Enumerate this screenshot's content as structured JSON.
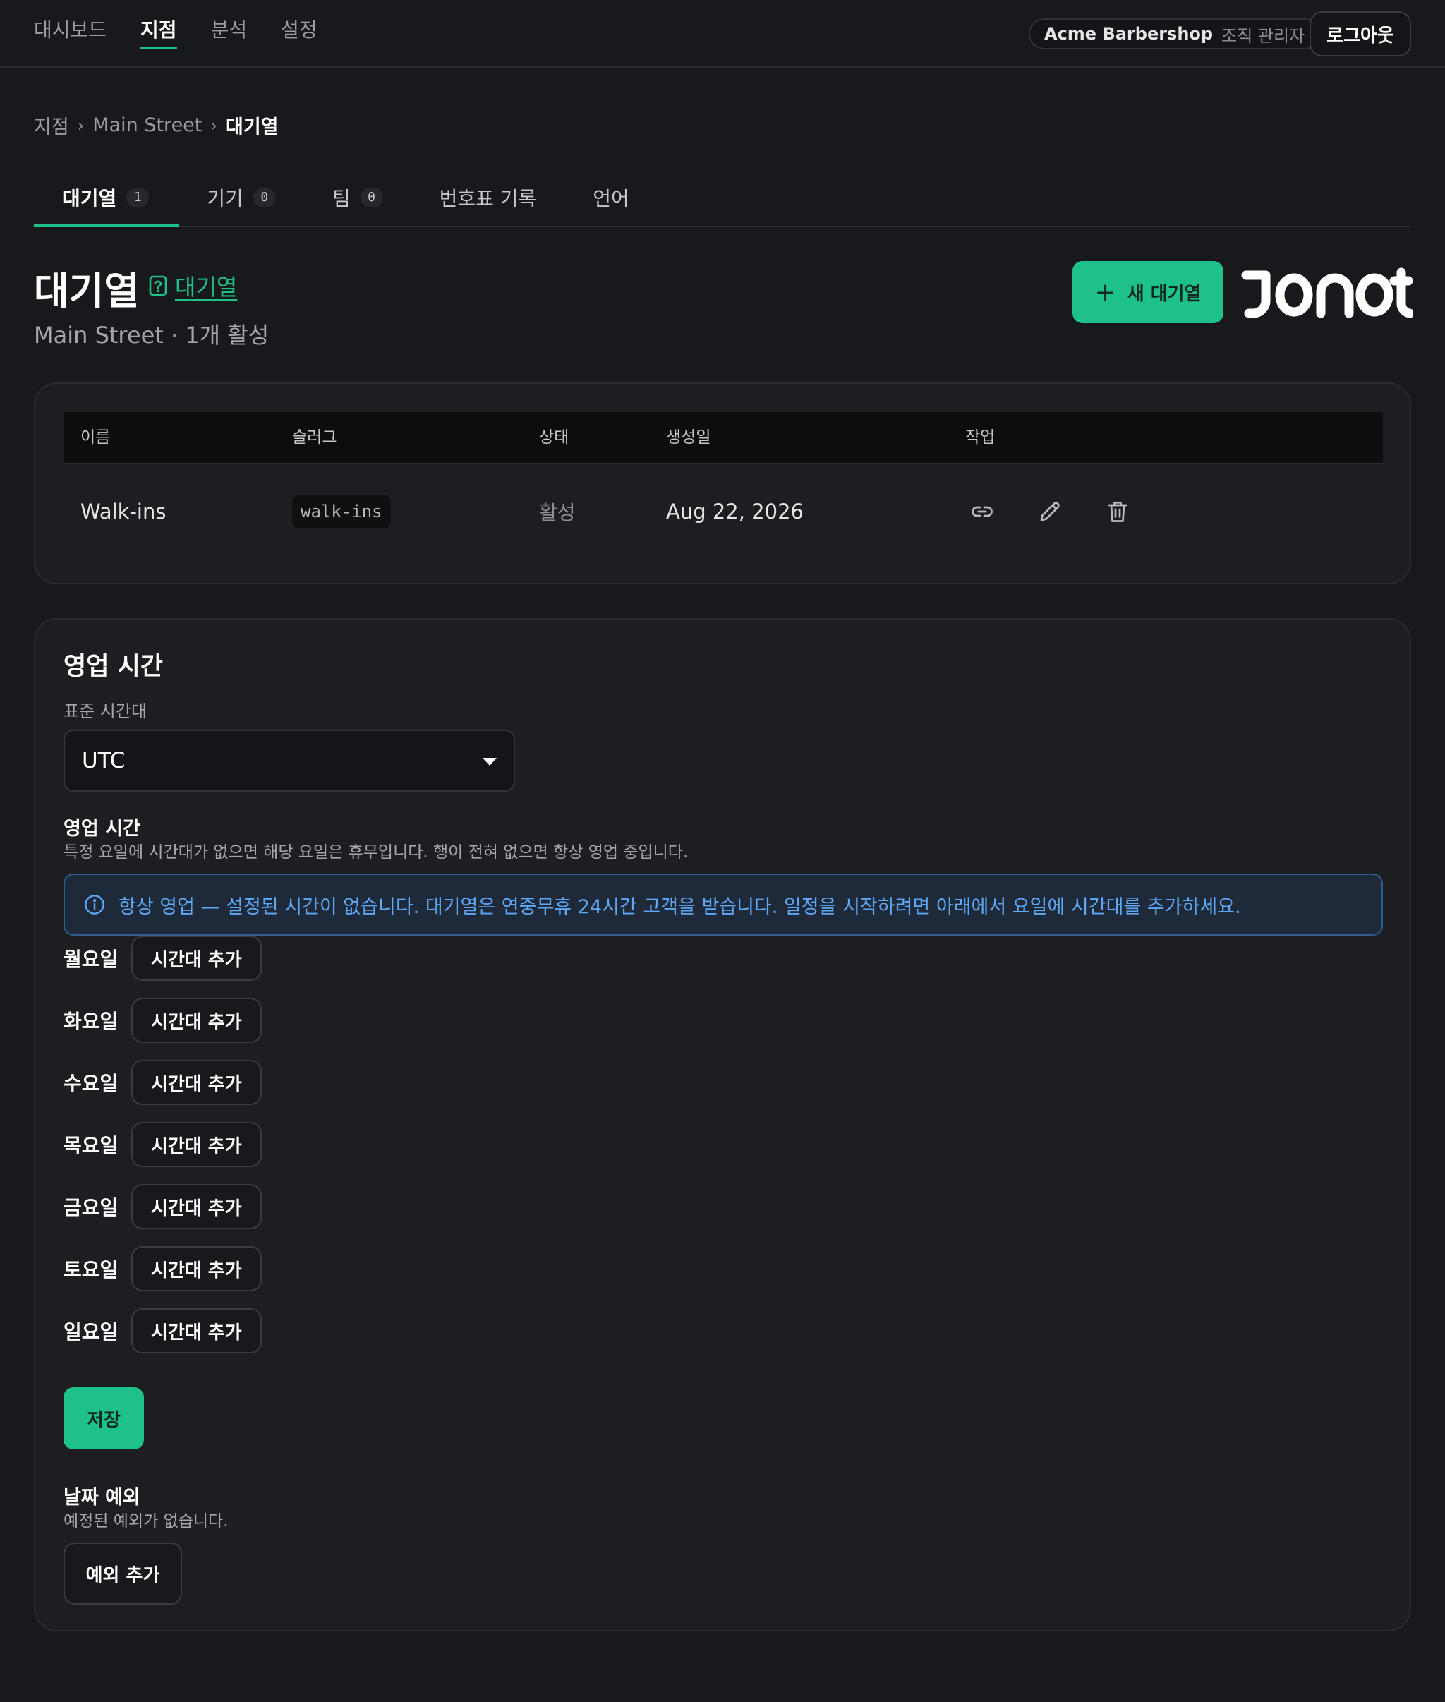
{
  "nav": {
    "items": [
      {
        "label": "대시보드"
      },
      {
        "label": "지점"
      },
      {
        "label": "분석"
      },
      {
        "label": "설정"
      }
    ]
  },
  "org": {
    "name": "Acme Barbershop",
    "role": "조직 관리자"
  },
  "logout_label": "로그아웃",
  "breadcrumb": {
    "items": [
      "지점",
      "Main Street",
      "대기열"
    ],
    "separator": "›"
  },
  "tabs": [
    {
      "label": "대기열",
      "count": "1"
    },
    {
      "label": "기기",
      "count": "0"
    },
    {
      "label": "팀",
      "count": "0"
    },
    {
      "label": "번호표 기록"
    },
    {
      "label": "언어"
    }
  ],
  "page": {
    "title": "대기열",
    "help_link": "대기열",
    "subtitle": "Main Street · 1개 활성",
    "new_button": "새 대기열",
    "brand_logo": "JONOT"
  },
  "queue_table": {
    "headers": [
      "이름",
      "슬러그",
      "상태",
      "생성일",
      "작업"
    ],
    "rows": [
      {
        "name": "Walk-ins",
        "slug": "walk-ins",
        "status": "활성",
        "created": "Aug 22, 2026"
      }
    ],
    "action_icons": [
      "link-icon",
      "pencil-icon",
      "trash-icon"
    ]
  },
  "hours": {
    "title": "영업 시간",
    "timezone_label": "표준 시간대",
    "timezone_value": "UTC",
    "schedule_title": "영업 시간",
    "schedule_help": "특정 요일에 시간대가 없으면 해당 요일은 휴무입니다. 행이 전혀 없으면 항상 영업 중입니다.",
    "banner": "항상 영업 — 설정된 시간이 없습니다. 대기열은 연중무휴 24시간 고객을 받습니다. 일정을 시작하려면 아래에서 요일에 시간대를 추가하세요.",
    "days": [
      {
        "label": "월요일",
        "button": "시간대 추가"
      },
      {
        "label": "화요일",
        "button": "시간대 추가"
      },
      {
        "label": "수요일",
        "button": "시간대 추가"
      },
      {
        "label": "목요일",
        "button": "시간대 추가"
      },
      {
        "label": "금요일",
        "button": "시간대 추가"
      },
      {
        "label": "토요일",
        "button": "시간대 추가"
      },
      {
        "label": "일요일",
        "button": "시간대 추가"
      }
    ],
    "save_label": "저장",
    "exceptions_title": "날짜 예외",
    "exceptions_empty": "예정된 예외가 없습니다.",
    "add_exception_label": "예외 추가"
  },
  "colors": {
    "background": "#18191c",
    "card": "#1d1e22",
    "accent": "#1fc18b",
    "info": "#5fa8f5"
  }
}
